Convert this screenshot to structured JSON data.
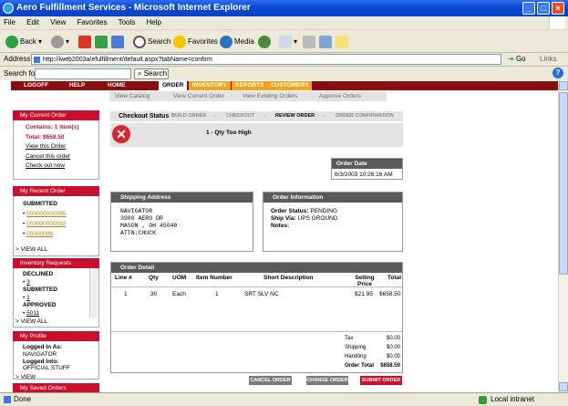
{
  "window": {
    "title": "Aero Fulfillment Services - Microsoft Internet Explorer"
  },
  "menu": [
    "File",
    "Edit",
    "View",
    "Favorites",
    "Tools",
    "Help"
  ],
  "toolbar": {
    "back": "Back",
    "search": "Search",
    "favorites": "Favorites",
    "media": "Media"
  },
  "address": {
    "label": "Address",
    "url": "http://iweb2003a/efulfillment/default.aspx?tabName=confirm",
    "go": "Go",
    "links": "Links"
  },
  "searchbar": {
    "label": "Search for",
    "button": "Search"
  },
  "nav": {
    "tabs": [
      "LOGOFF",
      "HELP",
      "HOME",
      "ORDER",
      "INVENTORY",
      "REPORTS",
      "CUSTOMERS"
    ],
    "active": "ORDER"
  },
  "subnav": [
    "View Catalog",
    "View Current Order",
    "View Existing Orders",
    "Approve Orders"
  ],
  "sidebar": {
    "current_order": {
      "title": "My Current Order",
      "contains": "Contains: 1 item(s)",
      "total": "Total: $658.50",
      "links": [
        "View this Order",
        "Cancel this order",
        "Check out now"
      ]
    },
    "recent_order": {
      "title": "My Recent Order",
      "status": "SUBMITTED",
      "orders": [
        "000000000095",
        "000000000092",
        "00000086"
      ],
      "view_all": "> VIEW ALL"
    },
    "inventory_requests": {
      "title": "Inventory Requests",
      "groups": [
        {
          "status": "DECLINED",
          "value": "3"
        },
        {
          "status": "SUBMITTED",
          "value": "1"
        },
        {
          "status": "APPROVED",
          "value": "5011"
        }
      ],
      "view_all": "> VIEW ALL"
    },
    "profile": {
      "title": "My Profile",
      "logged_in_as_label": "Logged In As:",
      "logged_in_as": "NAVIGATOR",
      "logged_into_label": "Logged Into:",
      "logged_into": "OFFICIAL STUFF",
      "view": "> VIEW"
    },
    "saved_orders": {
      "title": "My Saved Orders"
    }
  },
  "checkout": {
    "label": "Checkout Status",
    "steps": [
      "BUILD ORDER",
      "CHECKOUT",
      "REVIEW ORDER",
      "ORDER CONFIRMATION"
    ],
    "current_step": "REVIEW ORDER",
    "error": "1 - Qty Too High"
  },
  "order_date": {
    "label": "Order Date",
    "value": "6/3/2003 10:26:16 AM"
  },
  "shipping": {
    "title": "Shipping Address",
    "lines": [
      "NAVIGATOR",
      "3900 AERO DR",
      "MASON , OH 45040",
      "ATTN:CHUCK"
    ]
  },
  "order_info": {
    "title": "Order Information",
    "status_label": "Order Status:",
    "status": "PENDING",
    "shipvia_label": "Ship Via:",
    "shipvia": "UPS GROUND",
    "notes_label": "Notes:",
    "notes": ""
  },
  "order_detail": {
    "title": "Order Detail",
    "columns": [
      "Line #",
      "Qty",
      "UOM",
      "Item Number",
      "Short Description",
      "Selling Price",
      "Total"
    ],
    "rows": [
      {
        "line": "1",
        "qty": "30",
        "uom": "Each",
        "item": "1",
        "desc": "SRT SLV NC",
        "price": "$21.95",
        "total": "$658.50"
      }
    ],
    "summary": [
      {
        "label": "Tax",
        "value": "$0.00"
      },
      {
        "label": "Shipping",
        "value": "$0.00"
      },
      {
        "label": "Handling",
        "value": "$0.00"
      },
      {
        "label": "Order Total",
        "value": "$658.50"
      }
    ]
  },
  "buttons": {
    "cancel": "CANCEL ORDER",
    "change": "CHANGE ORDER",
    "submit": "SUBMIT ORDER"
  },
  "status": {
    "left": "Done",
    "zone": "Local intranet"
  },
  "colors": {
    "nav_red": "#8b0d0d",
    "accent_orange": "#f2a31b",
    "header_red": "#c8102e",
    "panel_gray": "#5a5a5a"
  }
}
